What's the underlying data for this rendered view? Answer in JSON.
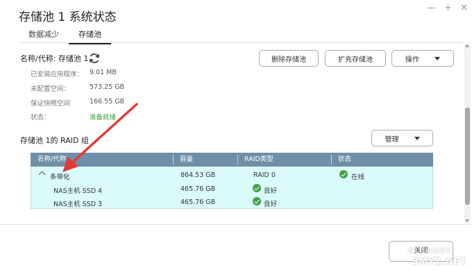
{
  "window": {
    "title": "存储池 1 系统状态",
    "controls": {
      "minimize": "—",
      "add": "+",
      "close": "✕"
    }
  },
  "tabs": [
    {
      "label": "数据减少",
      "active": false
    },
    {
      "label": "存储池",
      "active": true
    }
  ],
  "pool": {
    "name_label": "名称/代称: 存储池 1",
    "refresh_icon": "refresh-icon",
    "buttons": {
      "delete": "删除存储池",
      "expand": "扩充存储池",
      "actions": "操作"
    },
    "info": [
      {
        "label": "已安装应用程序：",
        "value": "9.01 MB"
      },
      {
        "label": "未配置空间：",
        "value": "573.25 GB"
      },
      {
        "label": "保证快照空间",
        "value": "166.55 GB"
      },
      {
        "label": "状态：",
        "value": "准备就绪"
      }
    ]
  },
  "raid": {
    "title": "存储池 1的 RAID 组",
    "manage_label": "管理",
    "headers": [
      "名称/代称",
      "容量",
      "RAID类型",
      "状态"
    ],
    "rows": [
      {
        "name": "条带化",
        "capacity": "864.53 GB",
        "raid_type": "RAID 0",
        "status": "在线"
      },
      {
        "name": "NAS主机 SSD 4",
        "capacity": "465.76 GB",
        "raid_type": "",
        "status": "良好"
      },
      {
        "name": "NAS主机 SSD 3",
        "capacity": "465.76 GB",
        "raid_type": "",
        "status": "良好"
      }
    ]
  },
  "footer": {
    "close_label": "关闭"
  },
  "watermark": {
    "text": "SMYZ.NET",
    "sub": "值 | 什么值得买"
  },
  "colors": {
    "accent_header": "#6f8fa8",
    "row_bg": "#dbfbfb",
    "status_ok": "#43a047",
    "ready_text": "#3aa13a",
    "annotation_arrow": "#e53935"
  }
}
